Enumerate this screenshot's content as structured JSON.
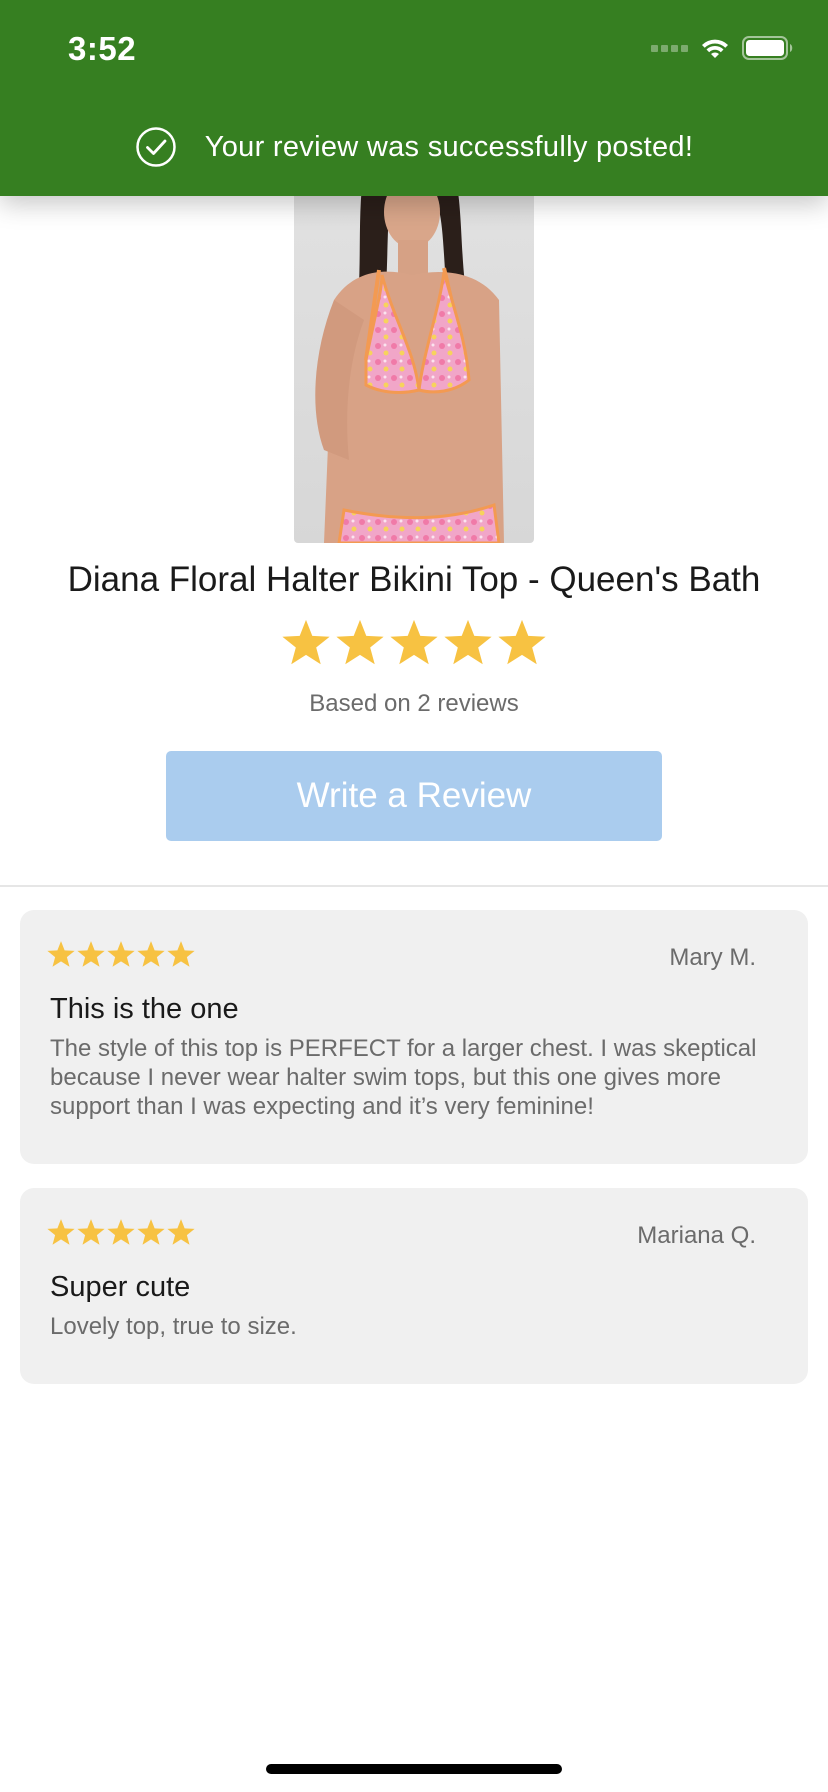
{
  "status_bar": {
    "time": "3:52"
  },
  "banner": {
    "message": "Your review was successfully posted!",
    "icon": "check-circle-icon",
    "background_color": "#367f21"
  },
  "product": {
    "image_description": "product-photo",
    "title": "Diana Floral Halter Bikini Top - Queen's Bath",
    "rating": 5,
    "rating_max": 5,
    "based_on": "Based on 2 reviews",
    "star_color": "#f7c242"
  },
  "write_review_button": {
    "label": "Write a Review",
    "color": "#aaccee"
  },
  "reviews": [
    {
      "rating": 5,
      "author": "Mary M.",
      "title": "This is the one",
      "body": "The style of this top is PERFECT for a larger chest. I was skeptical because I never wear halter swim tops, but this one gives more support than I was expecting and it’s very feminine!"
    },
    {
      "rating": 5,
      "author": "Mariana Q.",
      "title": "Super cute",
      "body": "Lovely top, true to size."
    }
  ]
}
